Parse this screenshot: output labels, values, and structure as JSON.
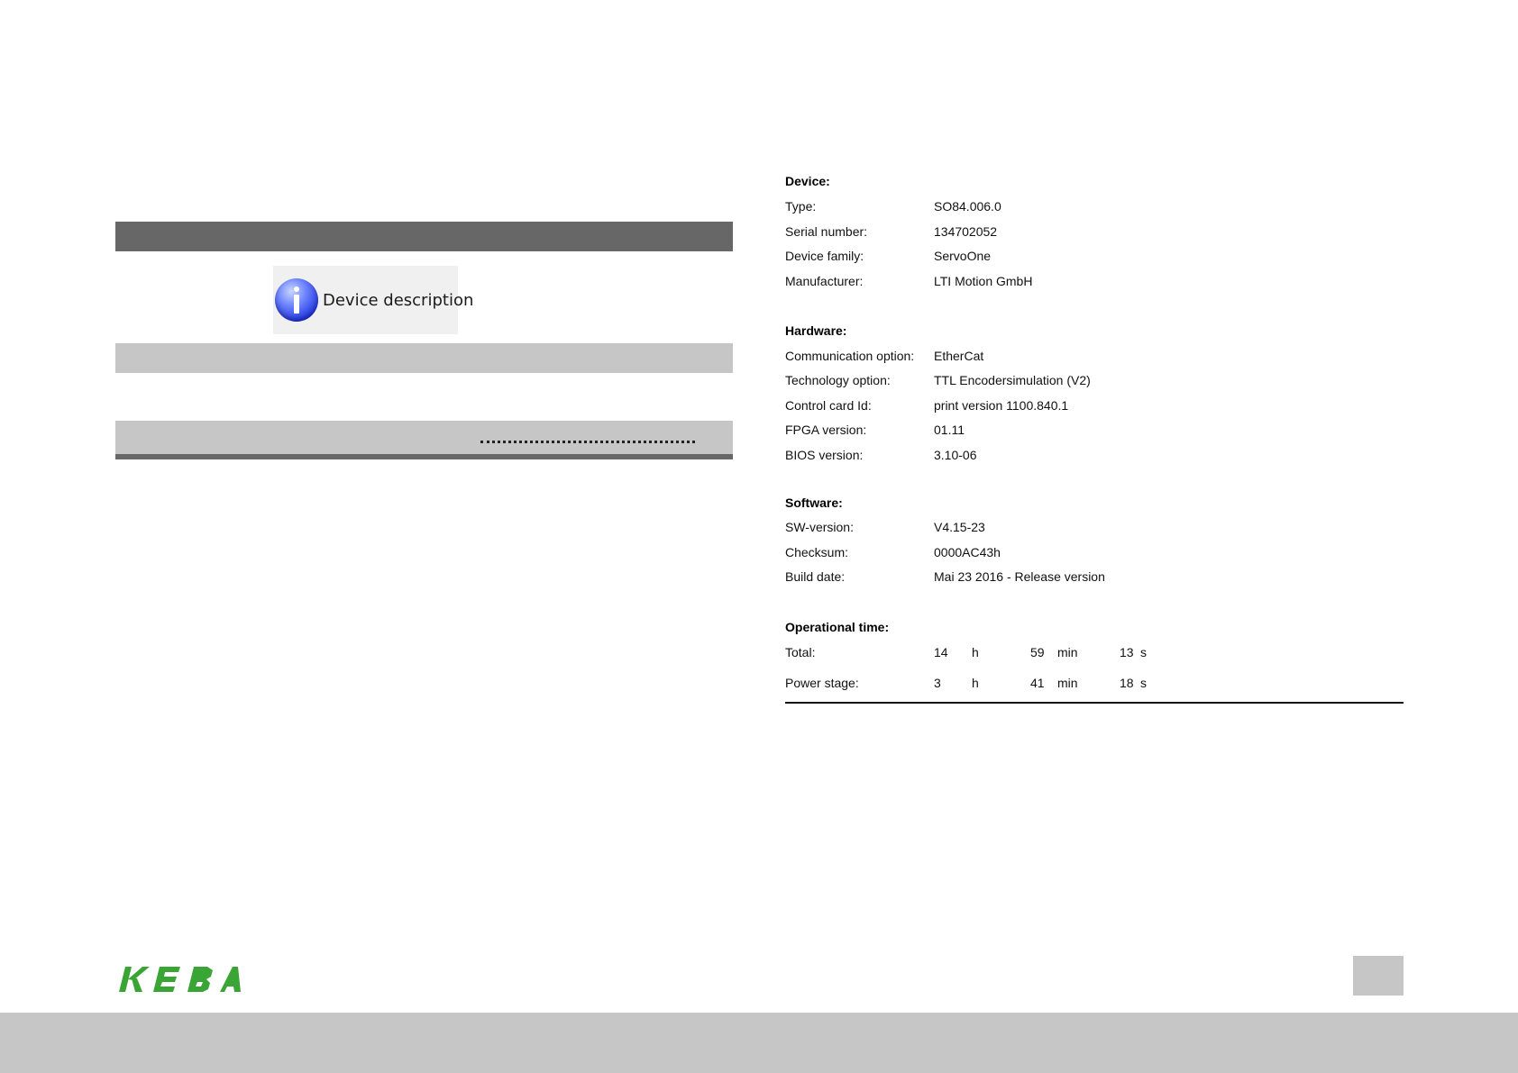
{
  "tool_button": {
    "label": "Device description",
    "icon": "info-icon"
  },
  "device_info": {
    "device": {
      "title": "Device:",
      "rows": [
        {
          "label": "Type:",
          "value": "SO84.006.0"
        },
        {
          "label": "Serial number:",
          "value": "134702052"
        },
        {
          "label": "Device family:",
          "value": "ServoOne"
        },
        {
          "label": "Manufacturer:",
          "value": "LTI Motion GmbH"
        }
      ]
    },
    "hardware": {
      "title": "Hardware:",
      "rows": [
        {
          "label": "Communication option:",
          "value": "EtherCat"
        },
        {
          "label": "Technology option:",
          "value": "TTL Encodersimulation (V2)"
        },
        {
          "label": "Control card Id:",
          "value": "print version 1100.840.1"
        },
        {
          "label": "FPGA version:",
          "value": "01.11"
        },
        {
          "label": "BIOS version:",
          "value": "3.10-06"
        }
      ]
    },
    "software": {
      "title": "Software:",
      "rows": [
        {
          "label": "SW-version:",
          "value": "V4.15-23"
        },
        {
          "label": "Checksum:",
          "value": "0000AC43h"
        },
        {
          "label": "Build date:",
          "value": "Mai 23 2016 - Release version"
        }
      ]
    },
    "operational_time": {
      "title": "Operational time:",
      "rows": [
        {
          "label": "Total:",
          "hours": "14",
          "h_unit": "h",
          "minutes": "59",
          "min_unit": "min",
          "seconds": "13",
          "s_unit": "s"
        },
        {
          "label": "Power stage:",
          "hours": "3",
          "h_unit": "h",
          "minutes": "41",
          "min_unit": "min",
          "seconds": "18",
          "s_unit": "s"
        }
      ]
    }
  },
  "footer": {
    "logo_text": "KEBA",
    "brand_color": "#3aa535"
  }
}
